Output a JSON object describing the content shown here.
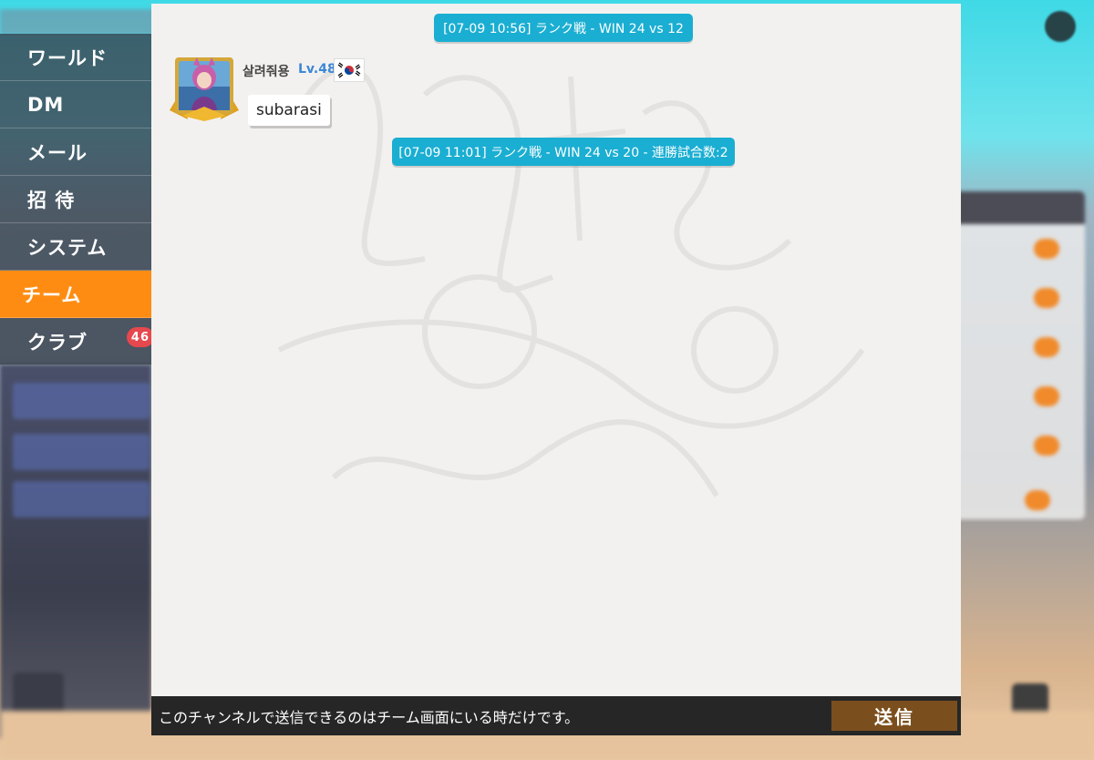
{
  "sidebar": {
    "items": [
      {
        "label": "ワールド"
      },
      {
        "label": "DM"
      },
      {
        "label": "メール"
      },
      {
        "label": "招 待"
      },
      {
        "label": "システム"
      },
      {
        "label": "チーム"
      },
      {
        "label": "クラブ",
        "badge": "46"
      }
    ],
    "active_index": 5
  },
  "chat": {
    "messages": [
      {
        "type": "system",
        "text": "[07-09 10:56] ランク戦 - WIN 24 vs 12"
      },
      {
        "type": "user",
        "username": "살려줘용",
        "level": "Lv.48",
        "flag": "south-korea-flag-icon",
        "text": "subarasi"
      },
      {
        "type": "system",
        "text": "[07-09 11:01] ランク戦 - WIN 24 vs 20 - 連勝試合数:2"
      }
    ]
  },
  "footer": {
    "notice": "このチャンネルで送信できるのはチーム画面にいる時だけです。",
    "send_label": "送信"
  },
  "colors": {
    "accent_orange": "#ff8c12",
    "system_blue": "#1aaed2",
    "send_brown": "#7b4f1d",
    "badge_red": "#e5484d",
    "level_blue": "#3b88d6"
  }
}
